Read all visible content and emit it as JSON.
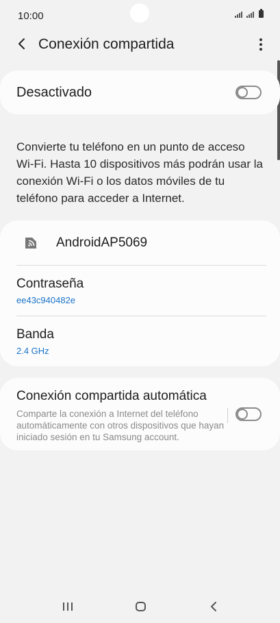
{
  "status_bar": {
    "time": "10:00"
  },
  "app_bar": {
    "title": "Conexión compartida",
    "back_icon": "back-arrow-icon",
    "more_icon": "more-vert-icon"
  },
  "master_switch": {
    "label": "Desactivado",
    "state": "off"
  },
  "description": "Convierte tu teléfono en un punto de acceso Wi-Fi. Hasta 10 dispositivos más podrán usar la conexión Wi-Fi o los datos móviles de tu teléfono para acceder a Internet.",
  "network": {
    "ssid": "AndroidAP5069",
    "icon": "hotspot-icon",
    "password_label": "Contraseña",
    "password_value": "ee43c940482e",
    "band_label": "Banda",
    "band_value": "2.4 GHz"
  },
  "auto_hotspot": {
    "title": "Conexión compartida automática",
    "subtitle": "Comparte la conexión a Internet del teléfono automáticamente con otros dispositivos que hayan iniciado sesión en tu Samsung account.",
    "state": "off"
  },
  "colors": {
    "background": "#f2f2f2",
    "card": "#fcfcfc",
    "accent": "#1a73c8"
  }
}
